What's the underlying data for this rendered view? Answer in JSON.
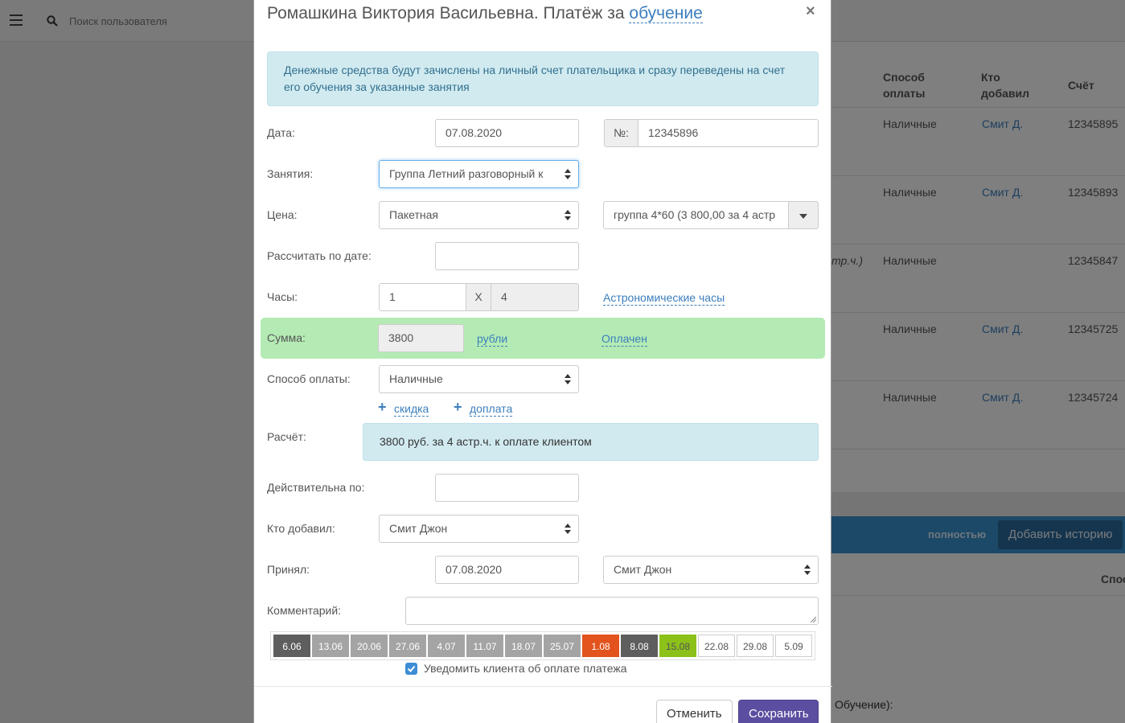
{
  "topbar": {
    "search_placeholder": "Поиск пользователя"
  },
  "background": {
    "top_cut_text": "",
    "headers": [
      "Способ оплаты",
      "Кто добавил",
      "Счёт"
    ],
    "rows": [
      {
        "method": "Наличные",
        "added_by": "Смит Д.",
        "account": "12345895",
        "note": ""
      },
      {
        "method": "Наличные",
        "added_by": "Смит Д.",
        "account": "12345893",
        "note": ""
      },
      {
        "method": "Наличные",
        "added_by": "",
        "account": "12345847",
        "note": "тр.ч.)"
      },
      {
        "method": "Наличные",
        "added_by": "Смит Д.",
        "account": "12345725",
        "note": ""
      },
      {
        "method": "Наличные",
        "added_by": "Смит Д.",
        "account": "12345724",
        "note": ""
      }
    ],
    "blue_bar_text": "полностью",
    "add_history_button": "Добавить историю",
    "lower_header": "Спос",
    "lower_text": "Обучение):"
  },
  "modal": {
    "title_main": "Ромашкина Виктория Васильевна. Платёж за",
    "title_link": "обучение",
    "close": "×",
    "info": "Денежные средства будут зачислены на личный счет плательщика и сразу переведены на счет его обучения за указанные занятия",
    "date_label": "Дата:",
    "date_value": "07.08.2020",
    "number_prefix": "№:",
    "number_value": "12345896",
    "lessons_label": "Занятия:",
    "lessons_value": "Группа Летний разговорный к",
    "price_label": "Цена:",
    "price_type": "Пакетная",
    "price_package": "группа 4*60 (3 800,00 за 4 астр",
    "calc_by_date_label": "Рассчитать по дате:",
    "calc_by_date_value": "",
    "hours_label": "Часы:",
    "hours_value": "1",
    "hours_x": "X",
    "hours_multiplier": "4",
    "hours_type_link": "Астрономические часы",
    "sum_label": "Сумма:",
    "sum_value": "3800",
    "currency_link": "рубли",
    "paid_link": "Оплачен",
    "payment_method_label": "Способ оплаты:",
    "payment_method_value": "Наличные",
    "discount_link": "скидка",
    "surcharge_link": "доплата",
    "plus": "+",
    "calc_label": "Расчёт:",
    "calc_text": "3800 руб. за 4 астр.ч. к оплате клиентом",
    "valid_until_label": "Действительна по:",
    "valid_until_value": "",
    "added_by_label": "Кто добавил:",
    "added_by_value": "Смит Джон",
    "accepted_label": "Принял:",
    "accepted_date": "07.08.2020",
    "accepted_by": "Смит Джон",
    "comment_label": "Комментарий:",
    "comment_value": "",
    "dates": [
      {
        "label": "6.06",
        "bg": "#5e5e5e",
        "fg": "#ffffff"
      },
      {
        "label": "13.06",
        "bg": "#a4a4a4",
        "fg": "#ffffff"
      },
      {
        "label": "20.06",
        "bg": "#a4a4a4",
        "fg": "#ffffff"
      },
      {
        "label": "27.06",
        "bg": "#a4a4a4",
        "fg": "#ffffff"
      },
      {
        "label": "4.07",
        "bg": "#a4a4a4",
        "fg": "#ffffff"
      },
      {
        "label": "11.07",
        "bg": "#a4a4a4",
        "fg": "#ffffff"
      },
      {
        "label": "18.07",
        "bg": "#a4a4a4",
        "fg": "#ffffff"
      },
      {
        "label": "25.07",
        "bg": "#a4a4a4",
        "fg": "#ffffff"
      },
      {
        "label": "1.08",
        "bg": "#e2531d",
        "fg": "#ffffff"
      },
      {
        "label": "8.08",
        "bg": "#5e5e5e",
        "fg": "#ffffff"
      },
      {
        "label": "15.08",
        "bg": "#8cc11a",
        "fg": "#555555"
      },
      {
        "label": "22.08",
        "bg": "#ffffff",
        "fg": "#555555"
      },
      {
        "label": "29.08",
        "bg": "#ffffff",
        "fg": "#555555"
      },
      {
        "label": "5.09",
        "bg": "#ffffff",
        "fg": "#555555"
      }
    ],
    "notify_label": "Уведомить клиента об оплате платежа",
    "notify_checked": true,
    "cancel_button": "Отменить",
    "save_button": "Сохранить"
  },
  "colors": {
    "accent": "#3c7ebd",
    "sum_bg": "#b4ebb4",
    "info_bg": "#d1eaf0",
    "save_bg": "#5b4ea0"
  }
}
